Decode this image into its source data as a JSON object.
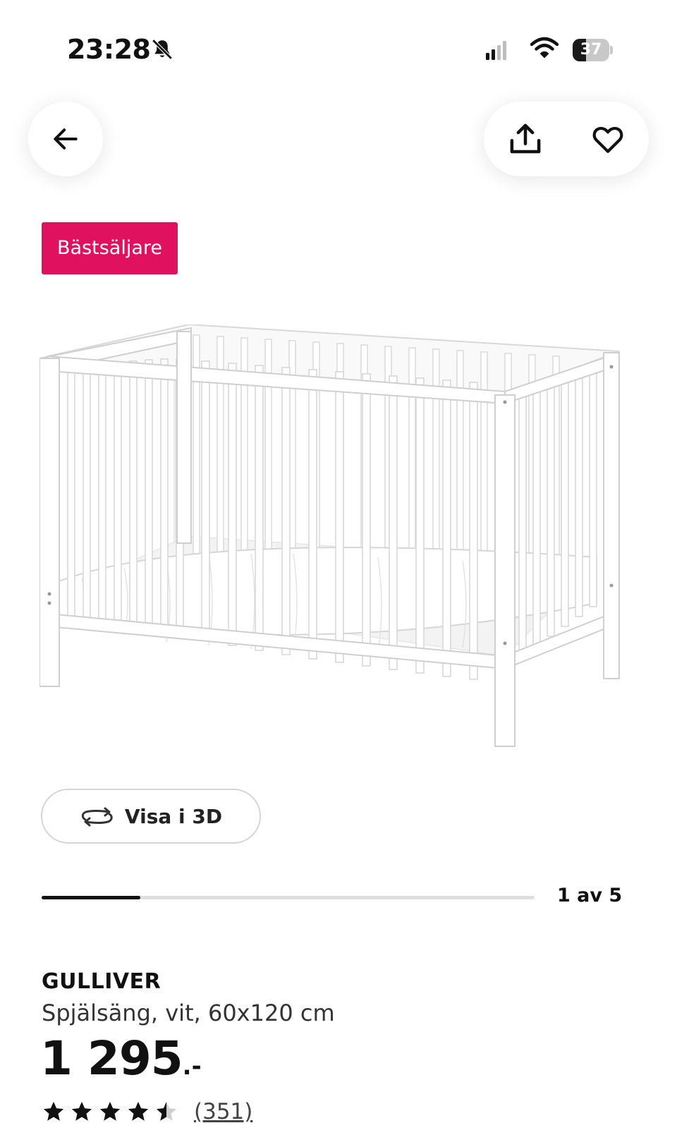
{
  "status_bar": {
    "time": "23:28",
    "battery": "37",
    "battery_level": 0.37,
    "icons": [
      "bell-slash-icon",
      "signal-icon",
      "wifi-icon",
      "battery-icon"
    ]
  },
  "toolbar": {
    "back_icon": "arrow-left-icon",
    "share_icon": "share-icon",
    "favorite_icon": "heart-icon"
  },
  "badge": {
    "label": "Bästsäljare",
    "color": "#e0115f"
  },
  "image": {
    "icon": "crib-image"
  },
  "view3d": {
    "label": "Visa i 3D",
    "icon": "rotate-icon"
  },
  "carousel": {
    "counter": "1 av 5",
    "current": 1,
    "total": 5
  },
  "product": {
    "name": "GULLIVER",
    "description": "Spjälsäng, vit, 60x120 cm",
    "price": "1 295",
    "price_suffix": ".-",
    "rating": 4.5,
    "review_count": "(351)"
  }
}
